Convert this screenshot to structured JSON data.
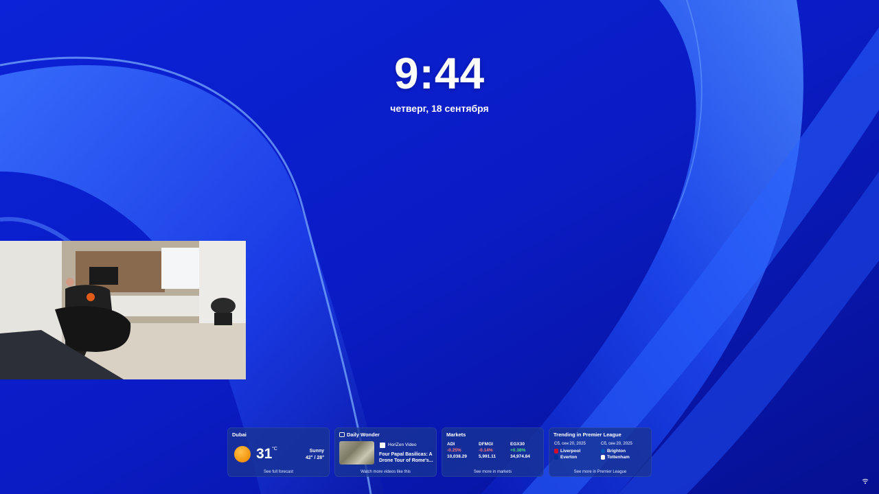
{
  "lockscreen": {
    "time": "9:44",
    "date": "четверг, 18 сентября"
  },
  "widgets": {
    "weather": {
      "title": "Dubai",
      "temperature": "31",
      "unit": "°C",
      "condition": "Sunny",
      "high_low": "42° / 28°",
      "link": "See full forecast",
      "icon": "sun-icon"
    },
    "video": {
      "title": "Daily Wonder",
      "source": "HoriZen Video",
      "headline": "Four Papal Basilicas: A Drone Tour of Rome's...",
      "link": "Watch more videos like this"
    },
    "markets": {
      "title": "Markets",
      "items": [
        {
          "symbol": "ADI",
          "change": "-0.25%",
          "value": "10,038.29"
        },
        {
          "symbol": "DFMGI",
          "change": "-0.14%",
          "value": "5,991.11"
        },
        {
          "symbol": "EGX30",
          "change": "+0.38%",
          "value": "34,974.84"
        }
      ],
      "link": "See more in markets"
    },
    "sports": {
      "title": "Trending in Premier League",
      "matches": [
        {
          "date": "Сб, сен 20, 2025",
          "home": "Liverpool",
          "away": "Everton"
        },
        {
          "date": "Сб, сен 20, 2025",
          "home": "Brighton",
          "away": "Tottenham"
        }
      ],
      "link": "See more in Premier League"
    }
  },
  "colors": {
    "negative": "#ff7a7a",
    "positive": "#4fe37a"
  }
}
